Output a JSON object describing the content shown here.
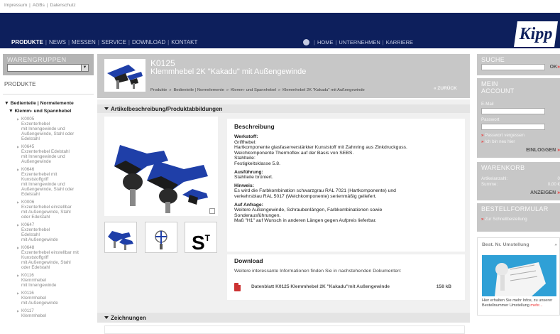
{
  "top_links": [
    "Impressum",
    "|",
    "AGBs",
    "|",
    "Datenschutz"
  ],
  "nav": {
    "items": [
      "PRODUKTE",
      "NEWS",
      "MESSEN",
      "SERVICE",
      "DOWNLOAD",
      "KONTAKT"
    ],
    "separator": "|",
    "right_items": [
      "HOME",
      "UNTERNEHMEN",
      "KARRIERE"
    ]
  },
  "logo_text": "Kipp",
  "sidebar": {
    "title": "WARENGRUPPEN",
    "select_value": "",
    "produkte_label": "PRODUKTE",
    "tree_l1": "Bedienteile | Normelemente",
    "tree_l2": "Klemm- und Spannhebel",
    "items": [
      {
        "code": "K0005",
        "lines": [
          "Exzenterhebel",
          "mit Innengewinde und",
          "Außengewinde, Stahl oder",
          "Edelstahl"
        ]
      },
      {
        "code": "K0645",
        "lines": [
          "Exzenterhebel Edelstahl",
          "mit Innengewinde und",
          "Außengewinde"
        ]
      },
      {
        "code": "K0646",
        "lines": [
          "Exzenterhebel mit",
          "Kunststoffgriff",
          "mit Innengewinde und",
          "Außengewinde, Stahl oder",
          "Edelstahl"
        ]
      },
      {
        "code": "K0006",
        "lines": [
          "Exzenterhebel einstellbar",
          "mit Außengewinde, Stahl",
          "oder Edelstahl"
        ]
      },
      {
        "code": "K0647",
        "lines": [
          "Exzenterhebel",
          "Edelstahl",
          "mit Außengewinde"
        ]
      },
      {
        "code": "K0648",
        "lines": [
          "Exzenterhebel einstellbar mit",
          "Kunststoffgriff",
          "mit Außengewinde, Stahl",
          "oder Edelstahl"
        ]
      },
      {
        "code": "K0116",
        "lines": [
          "Klemmhebel",
          "mit Innengewinde"
        ]
      },
      {
        "code": "K0116",
        "lines": [
          "Klemmhebel",
          "mit Außengewinde"
        ]
      },
      {
        "code": "K0117",
        "lines": [
          "Klemmhebel"
        ]
      }
    ]
  },
  "product": {
    "code": "K0125",
    "title": "Klemmhebel 2K \"Kakadu\" mit Außengewinde",
    "breadcrumbs": [
      "Produkte",
      "Bedienteile | Normelemente",
      "Klemm- und Spannhebel",
      "Klemmhebel 2K \"Kakadu\" mit Außengewinde"
    ],
    "breadcrumb_sep": "»",
    "back_label": "« ZURÜCK"
  },
  "section_title": "Artikelbeschreibung/Produktabbildungen",
  "thumb_st": {
    "main": "S",
    "sup": "T"
  },
  "description": {
    "title": "Beschreibung",
    "werkstoff_h": "Werkstoff:",
    "werkstoff": [
      "Griffhebel:",
      "Hartkomponente glasfaserverstärkter Kunststoff mit Zahnring aus Zinkdruckguss.",
      "Weichkomponente Thermoflex auf der Basis von SEBS.",
      "Stahlteile:",
      "Festigkeitsklasse 5.8."
    ],
    "ausfuehrung_h": "Ausführung:",
    "ausfuehrung": [
      "Stahlteile brüniert."
    ],
    "hinweis_h": "Hinweis:",
    "hinweis": [
      "Es wird die Farbkombination schwarzgrau RAL 7021 (Hartkomponente) und",
      "verkehrsblau RAL 5017 (Weichkomponente) serienmäßig geliefert."
    ],
    "anfrage_h": "Auf Anfrage:",
    "anfrage": [
      "Weitere Außengewinde, Schraubenlängen, Farbkombinationen sowie",
      "Sonderausführungen.",
      "Maß \"H1\" auf Wunsch in anderen Längen gegen Aufpreis lieferbar."
    ]
  },
  "download": {
    "title": "Download",
    "subtitle": "Weitere interessante Informationen finden Sie in nachstehenden Dokumenten:",
    "file_label": "Datenblatt K0125 Klemmhebel 2K \"Kakadu\"mit Außengewinde",
    "file_size": "158 kB"
  },
  "section2_title": "Zeichnungen",
  "right": {
    "search_title": "SUCHE",
    "search_btn": "OK",
    "account_title_1": "MEIN",
    "account_title_2": "ACCOUNT",
    "email_label": "E-Mail",
    "password_label": "Passwort",
    "forgot": "Passwort vergessen",
    "new_here": "Ich bin neu hier",
    "login_btn": "EINLOGGEN",
    "cart_title": "WARENKORB",
    "cart_count_label": "Artikelanzahl:",
    "cart_count": "0",
    "cart_sum_label": "Summe:",
    "cart_sum": "0,00 €",
    "show_btn": "ANZEIGEN",
    "order_title": "BESTELLFORMULAR",
    "quick_order": "Zur Schnellbestellung",
    "promo_title": "Best. Nr. Umstellung",
    "promo_arrow": "»",
    "promo_text": "Hier erhalten Sie mehr Infos, zu unserer Bestellnummer Umstellung",
    "promo_more": "mehr..."
  },
  "colors": {
    "header": "#0d1f5c",
    "accent": "#e33333",
    "panel": "#c7c7c7",
    "grip_blue": "#1f3fa8"
  }
}
